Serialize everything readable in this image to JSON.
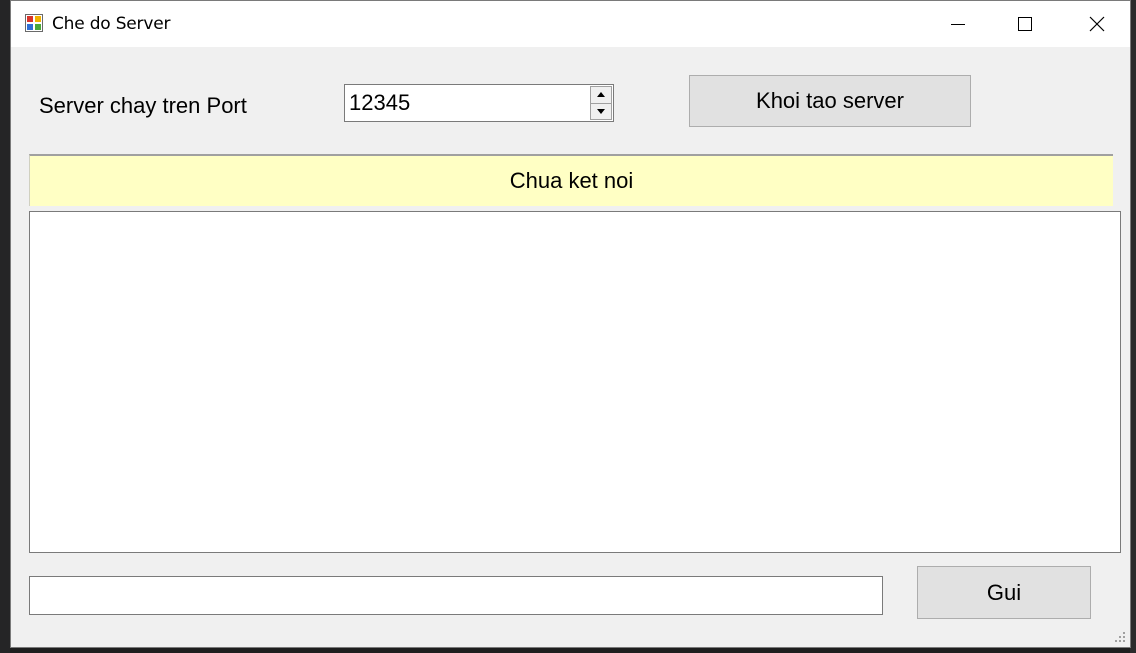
{
  "window": {
    "title": "Che do Server",
    "icon": "form-app-icon",
    "controls": {
      "minimize": "minimize-icon",
      "maximize": "maximize-icon",
      "close": "close-icon"
    }
  },
  "server": {
    "port_label": "Server chay tren Port",
    "port_value": "12345",
    "start_button_label": "Khoi tao server"
  },
  "status": {
    "text": "Chua ket noi",
    "background_color": "#ffffc4"
  },
  "messages": {
    "content": ""
  },
  "compose": {
    "input_value": "",
    "send_button_label": "Gui"
  }
}
